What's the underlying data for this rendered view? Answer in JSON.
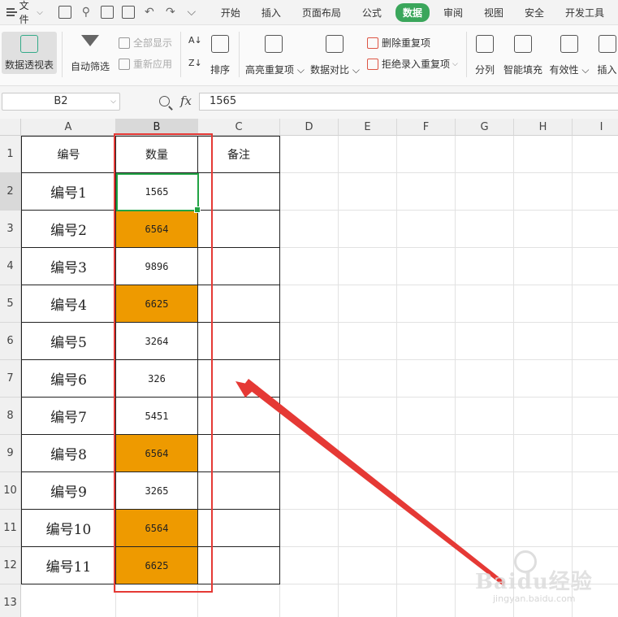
{
  "menubar": {
    "file_label": "文件",
    "tabs": [
      {
        "label": "开始",
        "active": false
      },
      {
        "label": "插入",
        "active": false
      },
      {
        "label": "页面布局",
        "active": false
      },
      {
        "label": "公式",
        "active": false
      },
      {
        "label": "数据",
        "active": true
      },
      {
        "label": "审阅",
        "active": false
      },
      {
        "label": "视图",
        "active": false
      },
      {
        "label": "安全",
        "active": false
      },
      {
        "label": "开发工具",
        "active": false
      }
    ]
  },
  "ribbon": {
    "pivot": "数据透视表",
    "autofilter": "自动筛选",
    "show_all": "全部显示",
    "reapply": "重新应用",
    "sort": "排序",
    "highlight_dup": "高亮重复项",
    "data_compare": "数据对比",
    "delete_dup": "删除重复项",
    "reject_dup": "拒绝录入重复项",
    "split_col": "分列",
    "smart_fill": "智能填充",
    "validity": "有效性",
    "insert": "插入"
  },
  "formula_bar": {
    "name_box": "B2",
    "fx": "fx",
    "value": "1565"
  },
  "sheet": {
    "columns": [
      "A",
      "B",
      "C",
      "D",
      "E",
      "F",
      "G",
      "H",
      "I"
    ],
    "rows": [
      "1",
      "2",
      "3",
      "4",
      "5",
      "6",
      "7",
      "8",
      "9",
      "10",
      "11",
      "12",
      "13"
    ],
    "header": {
      "a": "编号",
      "b": "数量",
      "c": "备注"
    },
    "data": [
      {
        "a": "编号1",
        "b": "1565",
        "highlight": false
      },
      {
        "a": "编号2",
        "b": "6564",
        "highlight": true
      },
      {
        "a": "编号3",
        "b": "9896",
        "highlight": false
      },
      {
        "a": "编号4",
        "b": "6625",
        "highlight": true
      },
      {
        "a": "编号5",
        "b": "3264",
        "highlight": false
      },
      {
        "a": "编号6",
        "b": "326",
        "highlight": false
      },
      {
        "a": "编号7",
        "b": "5451",
        "highlight": false
      },
      {
        "a": "编号8",
        "b": "6564",
        "highlight": true
      },
      {
        "a": "编号9",
        "b": "3265",
        "highlight": false
      },
      {
        "a": "编号10",
        "b": "6564",
        "highlight": true
      },
      {
        "a": "编号11",
        "b": "6625",
        "highlight": true
      }
    ],
    "highlight_color": "#ee9a00",
    "selection_color": "#21a344",
    "annotation_color": "#e53935"
  },
  "watermark": {
    "brand": "Baidu经验",
    "url": "jingyan.baidu.com"
  }
}
